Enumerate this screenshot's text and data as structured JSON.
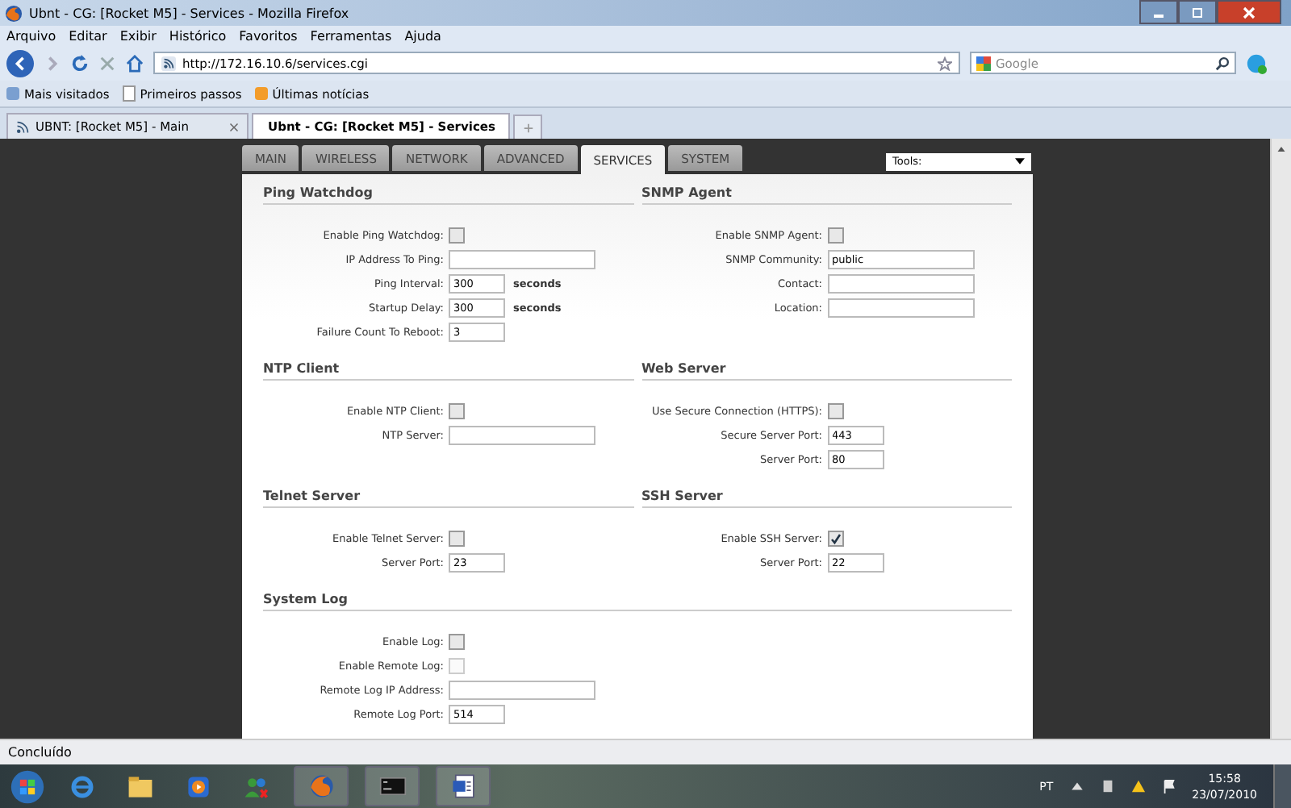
{
  "window": {
    "title": "Ubnt - CG: [Rocket M5] - Services - Mozilla Firefox"
  },
  "menu_bar": [
    "Arquivo",
    "Editar",
    "Exibir",
    "Histórico",
    "Favoritos",
    "Ferramentas",
    "Ajuda"
  ],
  "address_bar": {
    "value": "http://172.16.10.6/services.cgi"
  },
  "search": {
    "placeholder": "Google"
  },
  "bookmarks": [
    "Mais visitados",
    "Primeiros passos",
    "Últimas notícias"
  ],
  "browser_tabs": [
    {
      "label": "UBNT: [Rocket M5] - Main",
      "selected": false
    },
    {
      "label": "Ubnt - CG: [Rocket M5] - Services",
      "selected": true
    }
  ],
  "page_tabs": [
    {
      "label": "MAIN",
      "selected": false
    },
    {
      "label": "WIRELESS",
      "selected": false
    },
    {
      "label": "NETWORK",
      "selected": false
    },
    {
      "label": "ADVANCED",
      "selected": false
    },
    {
      "label": "SERVICES",
      "selected": true
    },
    {
      "label": "SYSTEM",
      "selected": false
    }
  ],
  "tools": {
    "value": "Tools:"
  },
  "section_rows": [
    [
      {
        "title": "Ping Watchdog",
        "fields": [
          {
            "kind": "checkbox",
            "label": "Enable Ping Watchdog:",
            "checked": false,
            "disabled": false
          },
          {
            "kind": "text",
            "label": "IP Address To Ping:"
          },
          {
            "kind": "number",
            "label": "Ping Interval:",
            "value": "300",
            "unit": "seconds"
          },
          {
            "kind": "number",
            "label": "Startup Delay:",
            "value": "300",
            "unit": "seconds"
          },
          {
            "kind": "number",
            "label": "Failure Count To Reboot:",
            "value": "3"
          }
        ]
      },
      {
        "title": "SNMP Agent",
        "fields": [
          {
            "kind": "checkbox",
            "label": "Enable SNMP Agent:",
            "checked": false,
            "disabled": false
          },
          {
            "kind": "text",
            "label": "SNMP Community:",
            "value": "public"
          },
          {
            "kind": "text",
            "label": "Contact:"
          },
          {
            "kind": "text",
            "label": "Location:"
          }
        ]
      }
    ],
    [
      {
        "title": "NTP Client",
        "fields": [
          {
            "kind": "checkbox",
            "label": "Enable NTP Client:",
            "checked": false,
            "disabled": false
          },
          {
            "kind": "text",
            "label": "NTP Server:"
          }
        ]
      },
      {
        "title": "Web Server",
        "fields": [
          {
            "kind": "checkbox",
            "label": "Use Secure Connection (HTTPS):",
            "checked": false,
            "disabled": false
          },
          {
            "kind": "number",
            "label": "Secure Server Port:",
            "value": "443"
          },
          {
            "kind": "number",
            "label": "Server Port:",
            "value": "80"
          }
        ]
      }
    ],
    [
      {
        "title": "Telnet Server",
        "fields": [
          {
            "kind": "checkbox",
            "label": "Enable Telnet Server:",
            "checked": false,
            "disabled": false
          },
          {
            "kind": "number",
            "label": "Server Port:",
            "value": "23"
          }
        ]
      },
      {
        "title": "SSH Server",
        "fields": [
          {
            "kind": "checkbox",
            "label": "Enable SSH Server:",
            "checked": true,
            "disabled": false
          },
          {
            "kind": "number",
            "label": "Server Port:",
            "value": "22"
          }
        ]
      }
    ],
    [
      {
        "title": "System Log",
        "fields": [
          {
            "kind": "checkbox",
            "label": "Enable Log:",
            "checked": false,
            "disabled": false
          },
          {
            "kind": "checkbox",
            "label": "Enable Remote Log:",
            "checked": false,
            "disabled": true
          },
          {
            "kind": "text",
            "label": "Remote Log IP Address:"
          },
          {
            "kind": "number",
            "label": "Remote Log Port:",
            "value": "514"
          }
        ]
      }
    ]
  ],
  "status_bar": {
    "text": "Concluído"
  },
  "taskbar": {
    "language": "PT",
    "time": "15:58",
    "date": "23/07/2010"
  }
}
